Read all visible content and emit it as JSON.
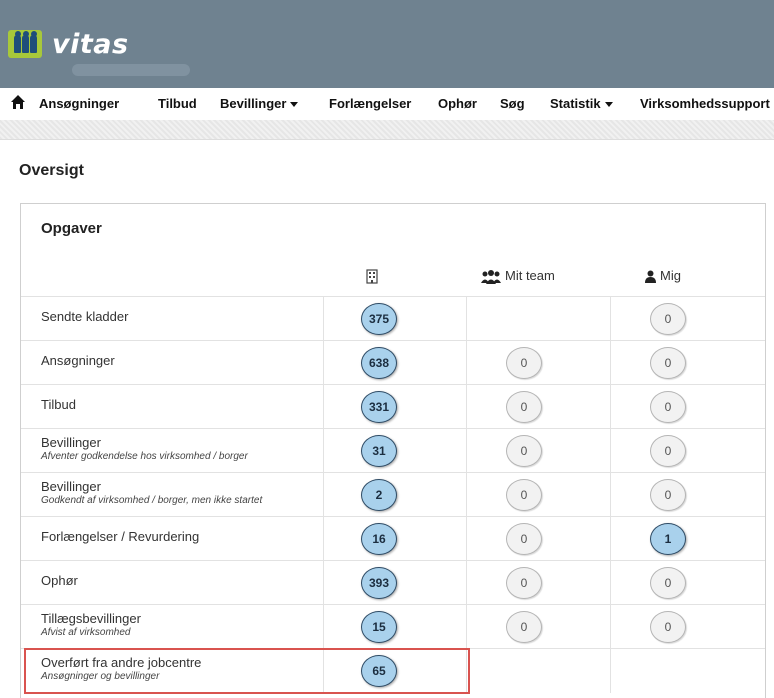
{
  "app": {
    "brand": "vitas"
  },
  "nav": {
    "items": [
      {
        "label": "Ansøgninger",
        "dropdown": false
      },
      {
        "label": "Tilbud",
        "dropdown": false
      },
      {
        "label": "Bevillinger",
        "dropdown": true
      },
      {
        "label": "Forlængelser",
        "dropdown": false
      },
      {
        "label": "Ophør",
        "dropdown": false
      },
      {
        "label": "Søg",
        "dropdown": false
      },
      {
        "label": "Statistik",
        "dropdown": true
      },
      {
        "label": "Virksomhedssupport",
        "dropdown": false
      }
    ]
  },
  "page": {
    "title": "Oversigt"
  },
  "panel": {
    "title": "Opgaver",
    "columns": {
      "team": "Mit team",
      "me": "Mig"
    },
    "rows": [
      {
        "label": "Sendte kladder",
        "sub": "",
        "all": "375",
        "team": "",
        "me": "0"
      },
      {
        "label": "Ansøgninger",
        "sub": "",
        "all": "638",
        "team": "0",
        "me": "0"
      },
      {
        "label": "Tilbud",
        "sub": "",
        "all": "331",
        "team": "0",
        "me": "0"
      },
      {
        "label": "Bevillinger",
        "sub": "Afventer godkendelse hos virksomhed / borger",
        "all": "31",
        "team": "0",
        "me": "0"
      },
      {
        "label": "Bevillinger",
        "sub": "Godkendt af virksomhed / borger, men ikke startet",
        "all": "2",
        "team": "0",
        "me": "0"
      },
      {
        "label": "Forlængelser / Revurdering",
        "sub": "",
        "all": "16",
        "team": "0",
        "me": "1"
      },
      {
        "label": "Ophør",
        "sub": "",
        "all": "393",
        "team": "0",
        "me": "0"
      },
      {
        "label": "Tillægsbevillinger",
        "sub": "Afvist af virksomhed",
        "all": "15",
        "team": "0",
        "me": "0"
      },
      {
        "label": "Overført fra andre jobcentre",
        "sub": "Ansøgninger og bevillinger",
        "all": "65",
        "team": "",
        "me": ""
      }
    ]
  },
  "colors": {
    "header_bg": "#6f8290",
    "bubble_active": "#a9d1ec",
    "highlight": "#d9534f"
  },
  "icons": {
    "home": "home-icon",
    "building": "building-icon",
    "team": "team-icon",
    "user": "user-icon"
  }
}
